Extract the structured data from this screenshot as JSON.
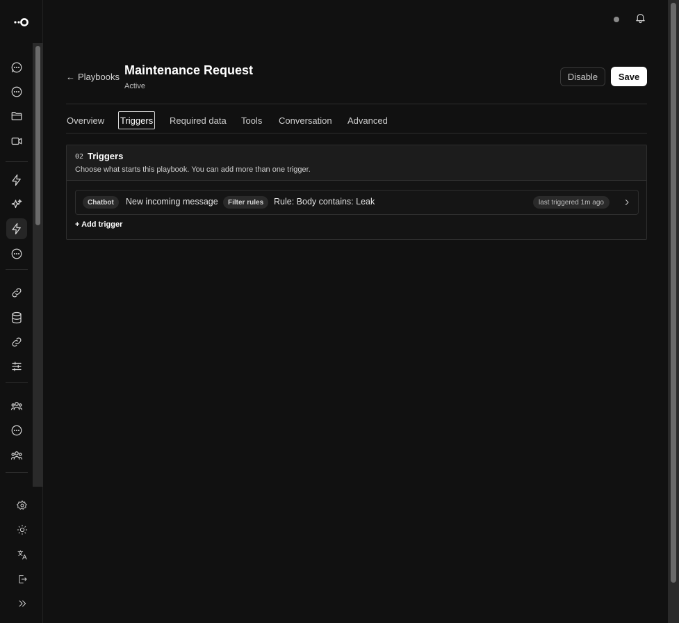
{
  "sidebar": {
    "logo_icon": "logo-icon",
    "nav": [
      {
        "icon": "chat-bubble-icon"
      },
      {
        "icon": "chat-bubble-icon"
      },
      {
        "icon": "folder-icon"
      },
      {
        "icon": "video-icon"
      },
      {
        "icon": "lightning-icon"
      },
      {
        "icon": "sparkles-icon"
      },
      {
        "icon": "lightning-icon",
        "active": true
      },
      {
        "icon": "chat-bubble-icon"
      },
      {
        "icon": "link-icon"
      },
      {
        "icon": "database-icon"
      },
      {
        "icon": "link-icon"
      },
      {
        "icon": "sliders-icon"
      },
      {
        "icon": "users-icon"
      },
      {
        "icon": "chat-bubble-icon"
      },
      {
        "icon": "users-icon"
      }
    ],
    "bottom": [
      {
        "icon": "settings-icon"
      },
      {
        "icon": "sun-icon"
      },
      {
        "icon": "translate-icon"
      },
      {
        "icon": "logout-icon"
      },
      {
        "icon": "chevrons-right-icon"
      }
    ]
  },
  "topbar": {
    "notification_icon": "bell-icon"
  },
  "header": {
    "back_label": "Playbooks",
    "title": "Maintenance Request",
    "status": "Active",
    "disable_label": "Disable",
    "save_label": "Save"
  },
  "tabs": [
    {
      "label": "Overview"
    },
    {
      "label": "Triggers",
      "active": true
    },
    {
      "label": "Required data"
    },
    {
      "label": "Tools"
    },
    {
      "label": "Conversation"
    },
    {
      "label": "Advanced"
    }
  ],
  "triggers_section": {
    "number": "02",
    "title": "Triggers",
    "description": "Choose what starts this playbook. You can add more than one trigger.",
    "items": [
      {
        "source": "Chatbot",
        "event": "New incoming message",
        "filter_label": "Filter rules",
        "rule": "Rule: Body contains: Leak",
        "last_triggered": "last triggered 1m ago"
      }
    ],
    "add_label": "+ Add trigger"
  },
  "colors": {
    "background": "#111111",
    "card_header": "#1c1c1c",
    "primary_button": "#ffffff",
    "status_dot": "#8a8a8a"
  }
}
